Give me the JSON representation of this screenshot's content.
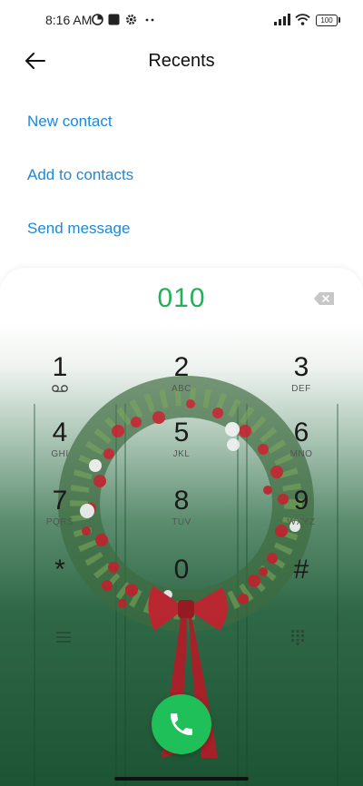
{
  "status_bar": {
    "time": "8:16 AM",
    "battery": "100",
    "icons": [
      "data-saver-icon",
      "square-notification-icon",
      "settings-icon",
      "more-dots-icon",
      "signal-icon",
      "wifi-icon",
      "battery-icon"
    ]
  },
  "header": {
    "title": "Recents",
    "back_icon": "back-arrow-icon"
  },
  "actions": [
    {
      "label": "New contact"
    },
    {
      "label": "Add to contacts"
    },
    {
      "label": "Send message"
    }
  ],
  "dialer": {
    "number": "010",
    "backspace_icon": "backspace-icon",
    "keys": [
      {
        "digit": "1",
        "letters": ""
      },
      {
        "digit": "2",
        "letters": "ABC"
      },
      {
        "digit": "3",
        "letters": "DEF"
      },
      {
        "digit": "4",
        "letters": "GHI"
      },
      {
        "digit": "5",
        "letters": "JKL"
      },
      {
        "digit": "6",
        "letters": "MNO"
      },
      {
        "digit": "7",
        "letters": "PQRS"
      },
      {
        "digit": "8",
        "letters": "TUV"
      },
      {
        "digit": "9",
        "letters": "WXYZ"
      },
      {
        "digit": "*",
        "letters": ""
      },
      {
        "digit": "0",
        "letters": ""
      },
      {
        "digit": "#",
        "letters": ""
      }
    ],
    "menu_icon": "menu-icon",
    "keypad_icon": "keypad-icon",
    "call_icon": "phone-icon",
    "colors": {
      "number": "#22b05a",
      "call_button": "#1fbf5a",
      "link": "#1e88d8"
    }
  }
}
